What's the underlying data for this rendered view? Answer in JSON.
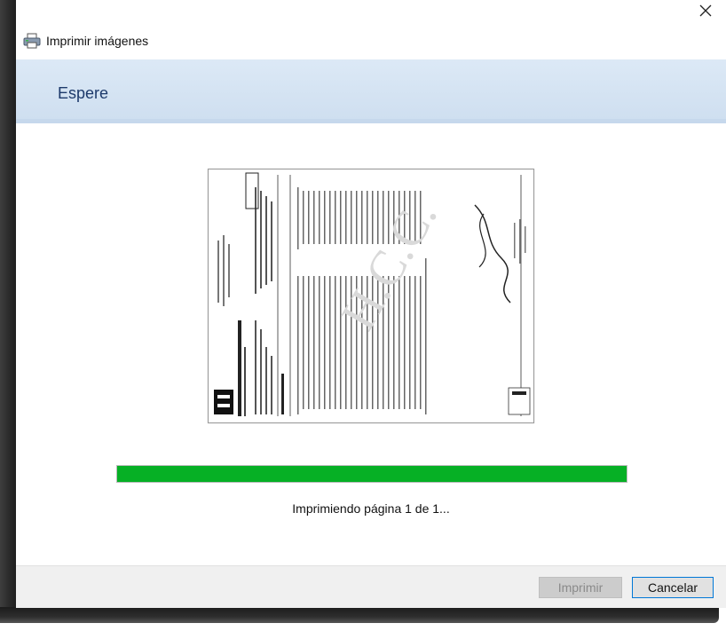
{
  "window": {
    "title": "Imprimir imágenes",
    "close_icon": "close-icon"
  },
  "banner": {
    "text": "Espere"
  },
  "preview": {
    "description_icon": "document-preview",
    "hospital_name": "HOSPITAL DE CLINICAS CARACAS",
    "section": "Hematología",
    "watermark": "H.C.C."
  },
  "progress": {
    "fraction": 1.0,
    "color": "#06b025"
  },
  "status": {
    "text": "Imprimiendo página 1 de 1..."
  },
  "footer": {
    "print_label": "Imprimir",
    "cancel_label": "Cancelar"
  },
  "colors": {
    "accent": "#0078d7",
    "banner": "#dce9f6",
    "banner_text": "#1d3a6b"
  }
}
